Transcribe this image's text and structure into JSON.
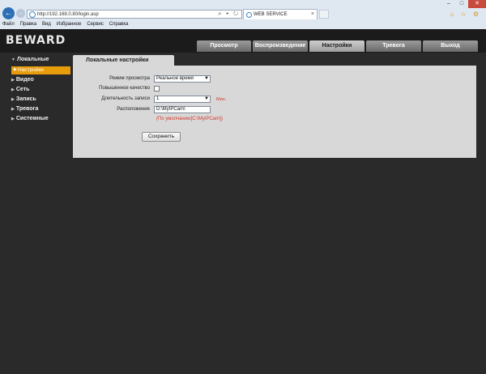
{
  "browser": {
    "url": "http://192.168.0.80/login.asp",
    "url_controls": "⌕ ▾ ↻",
    "tab_title": "WEB SERVICE",
    "window_controls": [
      "–",
      "□",
      "✕"
    ],
    "toolbar_icons": "⌂ ☆ ⚙",
    "menu": [
      "Файл",
      "Правка",
      "Вид",
      "Избранное",
      "Сервис",
      "Справка"
    ]
  },
  "app": {
    "logo": "BEWARD",
    "tabs": [
      "Просмотр",
      "Воспроизведение",
      "Настройки",
      "Тревога",
      "Выход"
    ],
    "active_tab": "Настройки"
  },
  "sidebar": {
    "items": [
      "Локальные",
      "Видео",
      "Сеть",
      "Запись",
      "Тревога",
      "Системные"
    ],
    "subitem": "Настройки"
  },
  "panel": {
    "title": "Локальные настройки",
    "mode_label": "Режим просмотра",
    "mode_value": "Реальное время",
    "quality_label": "Повышенное качество",
    "duration_label": "Длительность записи",
    "duration_value": "1",
    "duration_unit": "Мин.",
    "location_label": "Расположение",
    "location_value": "D:\\MyIPCam\\",
    "location_hint": "(По умолчанию[C:\\MyIPCam])",
    "save_label": "Сохранить"
  }
}
